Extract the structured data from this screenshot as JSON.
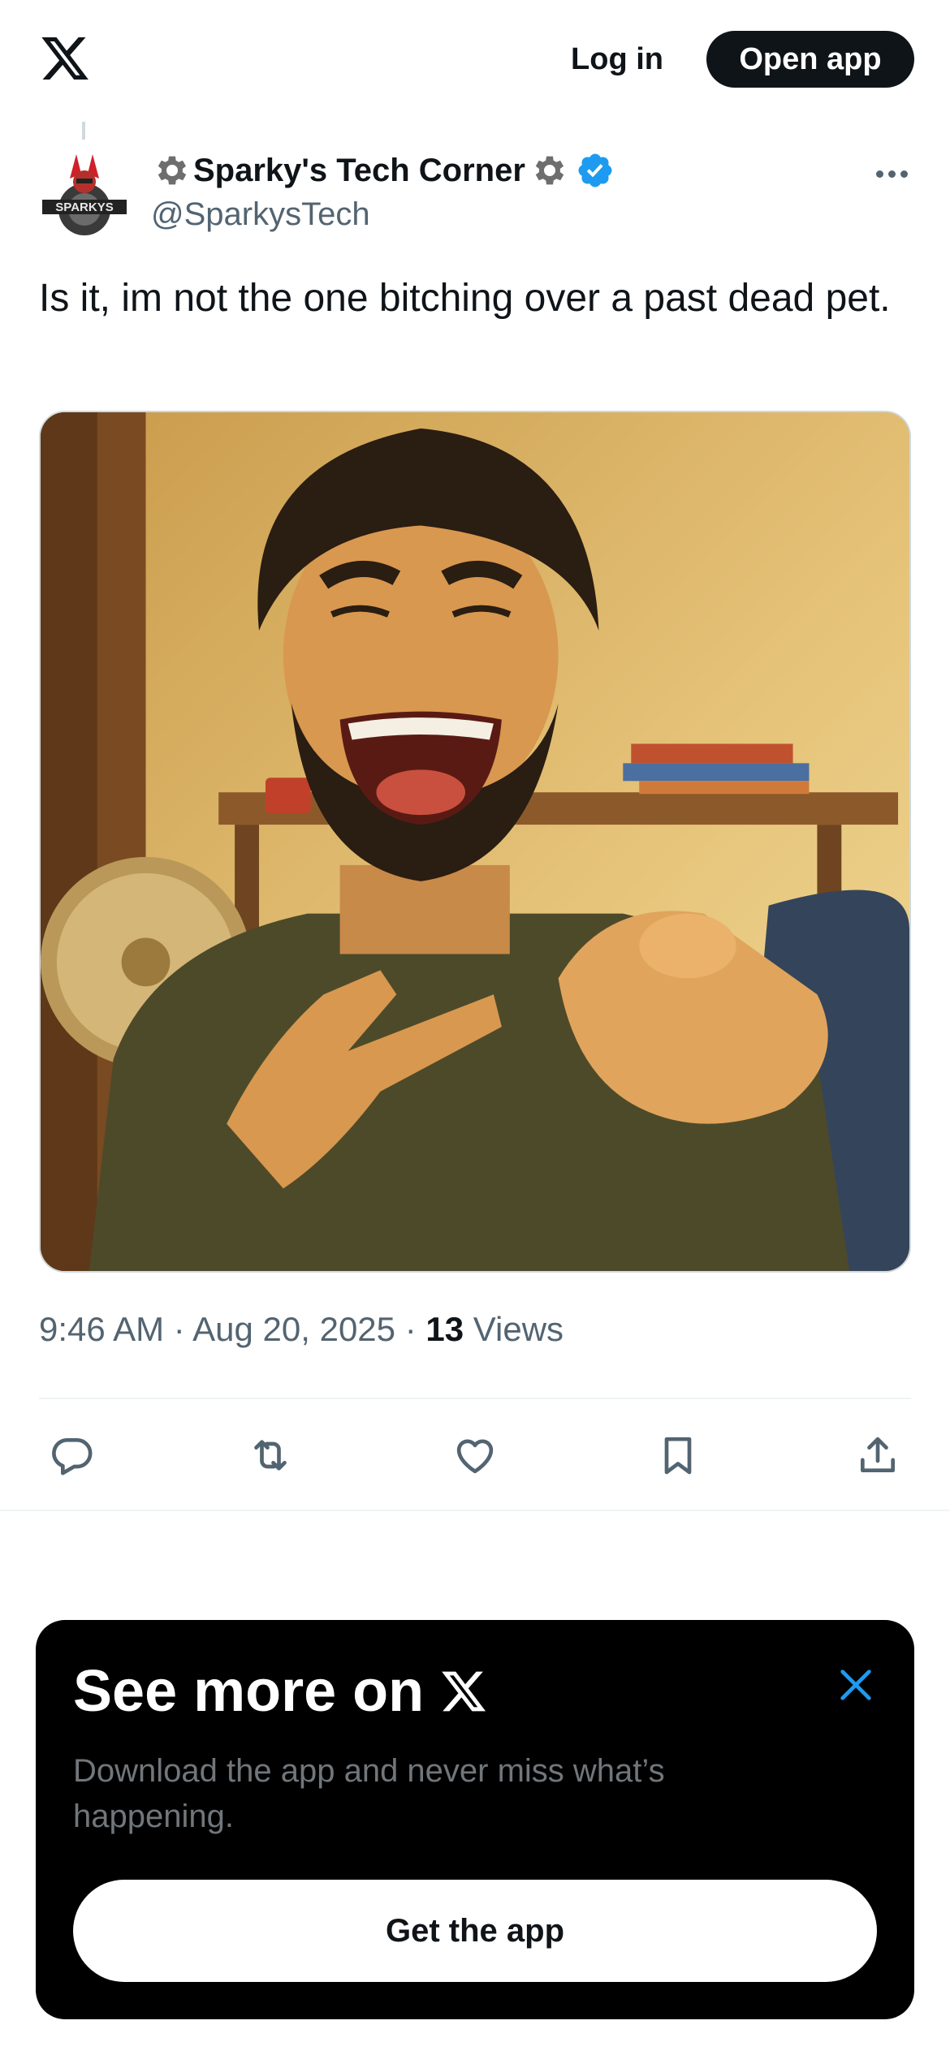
{
  "header": {
    "logo_icon": "x-logo-icon",
    "login_label": "Log in",
    "open_app_label": "Open app"
  },
  "tweet": {
    "display_name": "Sparky's Tech Corner",
    "handle": "@SparkysTech",
    "verified": true,
    "name_icons": [
      "gear-icon",
      "gear-icon",
      "verified-badge-icon"
    ],
    "text": "Is it, im not the one bitching over a past dead pet.",
    "time": "9:46 AM",
    "separator": "·",
    "date": "Aug 20, 2025",
    "views_count": "13",
    "views_label": "Views",
    "media_alt": "Illustration of a laughing bearded man pointing at the viewer",
    "actions": [
      "reply-icon",
      "retweet-icon",
      "like-icon",
      "bookmark-icon",
      "share-icon"
    ]
  },
  "promo": {
    "title": "See more on",
    "subtitle": "Download the app and never miss what’s happening.",
    "button_label": "Get the app"
  },
  "colors": {
    "text_primary": "#0f1419",
    "text_secondary": "#536471",
    "verified_blue": "#1d9bf0",
    "promo_bg": "#000000"
  }
}
